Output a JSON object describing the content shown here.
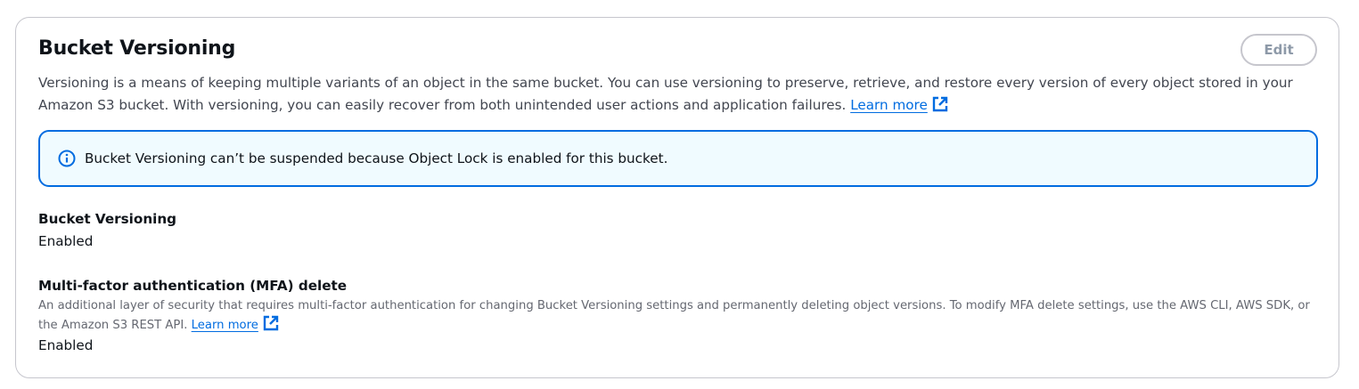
{
  "panel": {
    "title": "Bucket Versioning",
    "edit_label": "Edit",
    "description": "Versioning is a means of keeping multiple variants of an object in the same bucket. You can use versioning to preserve, retrieve, and restore every version of every object stored in your Amazon S3 bucket. With versioning, you can easily recover from both unintended user actions and application failures.",
    "learn_more_label": "Learn more"
  },
  "alert": {
    "icon": "info-icon",
    "text": "Bucket Versioning can’t be suspended because Object Lock is enabled for this bucket.",
    "color": "#006ce0"
  },
  "versioning": {
    "label": "Bucket Versioning",
    "value": "Enabled"
  },
  "mfa_delete": {
    "label": "Multi-factor authentication (MFA) delete",
    "description": "An additional layer of security that requires multi-factor authentication for changing Bucket Versioning settings and permanently deleting object versions. To modify MFA delete settings, use the AWS CLI, AWS SDK, or the Amazon S3 REST API.",
    "learn_more_label": "Learn more",
    "value": "Enabled"
  },
  "colors": {
    "link": "#006ce0",
    "border": "#c6c6cd",
    "alert_background": "#f0fbff"
  }
}
